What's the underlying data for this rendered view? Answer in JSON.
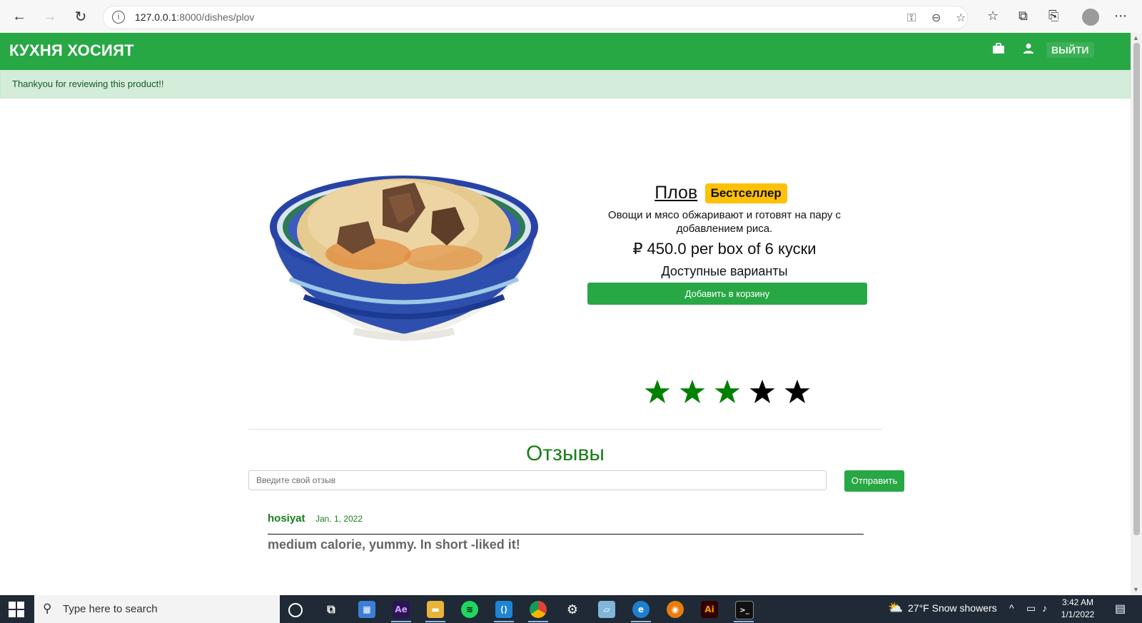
{
  "browser": {
    "url_host": "127.0.0.1",
    "url_path": ":8000/dishes/plov"
  },
  "site": {
    "brand": "КУХНЯ ХОСИЯТ",
    "logout_label": "ВЫЙТИ",
    "alert": "Thankyou for reviewing this product!!"
  },
  "product": {
    "name": "Плов",
    "badge": "Бестселлер",
    "description": "Овощи и мясо обжаривают и готовят на пару с добавлением риса.",
    "price": "₽ 450.0 per box of 6 куски",
    "variants_heading": "Доступные варианты",
    "add_to_cart_label": "Добавить в корзину",
    "rating": {
      "value": 3,
      "max": 5,
      "filled_color": "#008000",
      "empty_color": "#000000"
    }
  },
  "reviews": {
    "heading": "Отзывы",
    "input_placeholder": "Введите свой отзыв",
    "submit_label": "Отправить",
    "items": [
      {
        "author": "hosiyat",
        "date": "Jan. 1, 2022",
        "text": "medium calorie, yummy. In short -liked it!"
      }
    ]
  },
  "taskbar": {
    "search_placeholder": "Type here to search",
    "weather": "27°F  Snow showers",
    "time": "3:42 AM",
    "date": "1/1/2022"
  },
  "colors": {
    "primary": "#28a745",
    "badge": "#ffc107",
    "alert_bg": "#d4edda",
    "alert_text": "#155724"
  }
}
